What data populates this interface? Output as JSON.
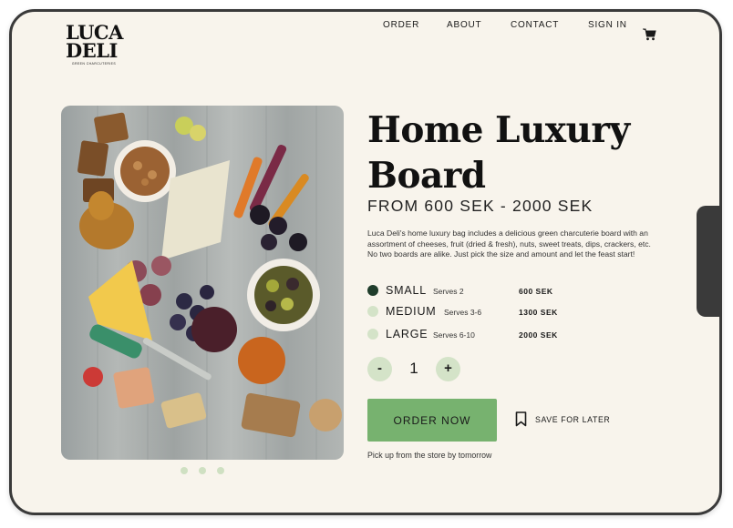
{
  "brand": {
    "name_line1": "LUCA",
    "name_line2": "DELI",
    "tagline": "GREEN CHARCUTERIES"
  },
  "nav": {
    "items": [
      "ORDER",
      "ABOUT",
      "CONTACT",
      "SIGN IN"
    ],
    "cart_icon": "cart-icon"
  },
  "product": {
    "title": "Home Luxury Board",
    "price_range": "FROM 600 SEK - 2000 SEK",
    "description": "Luca Deli's home luxury bag includes a delicious green charcuterie board with an assortment of cheeses, fruit (dried & fresh), nuts, sweet treats, dips, crackers, etc. No two boards are alike. Just pick the size and amount and let the feast start!",
    "sizes": [
      {
        "name": "SMALL",
        "serves": "Serves 2",
        "price": "600 SEK",
        "selected": true
      },
      {
        "name": "MEDIUM",
        "serves": "Serves 3-6",
        "price": "1300 SEK",
        "selected": false
      },
      {
        "name": "LARGE",
        "serves": "Serves 6-10",
        "price": "2000 SEK",
        "selected": false
      }
    ],
    "quantity": {
      "minus": "-",
      "value": "1",
      "plus": "+"
    },
    "order_button": "ORDER NOW",
    "save_label": "SAVE FOR LATER",
    "pickup_note": "Pick up from the store by tomorrow"
  },
  "carousel": {
    "count": 3,
    "active": 0
  },
  "colors": {
    "background": "#f8f4ec",
    "accent_green": "#77b26f",
    "light_green": "#d4e3c8",
    "dark_green": "#1f3d2b",
    "frame": "#3a3a3a"
  }
}
